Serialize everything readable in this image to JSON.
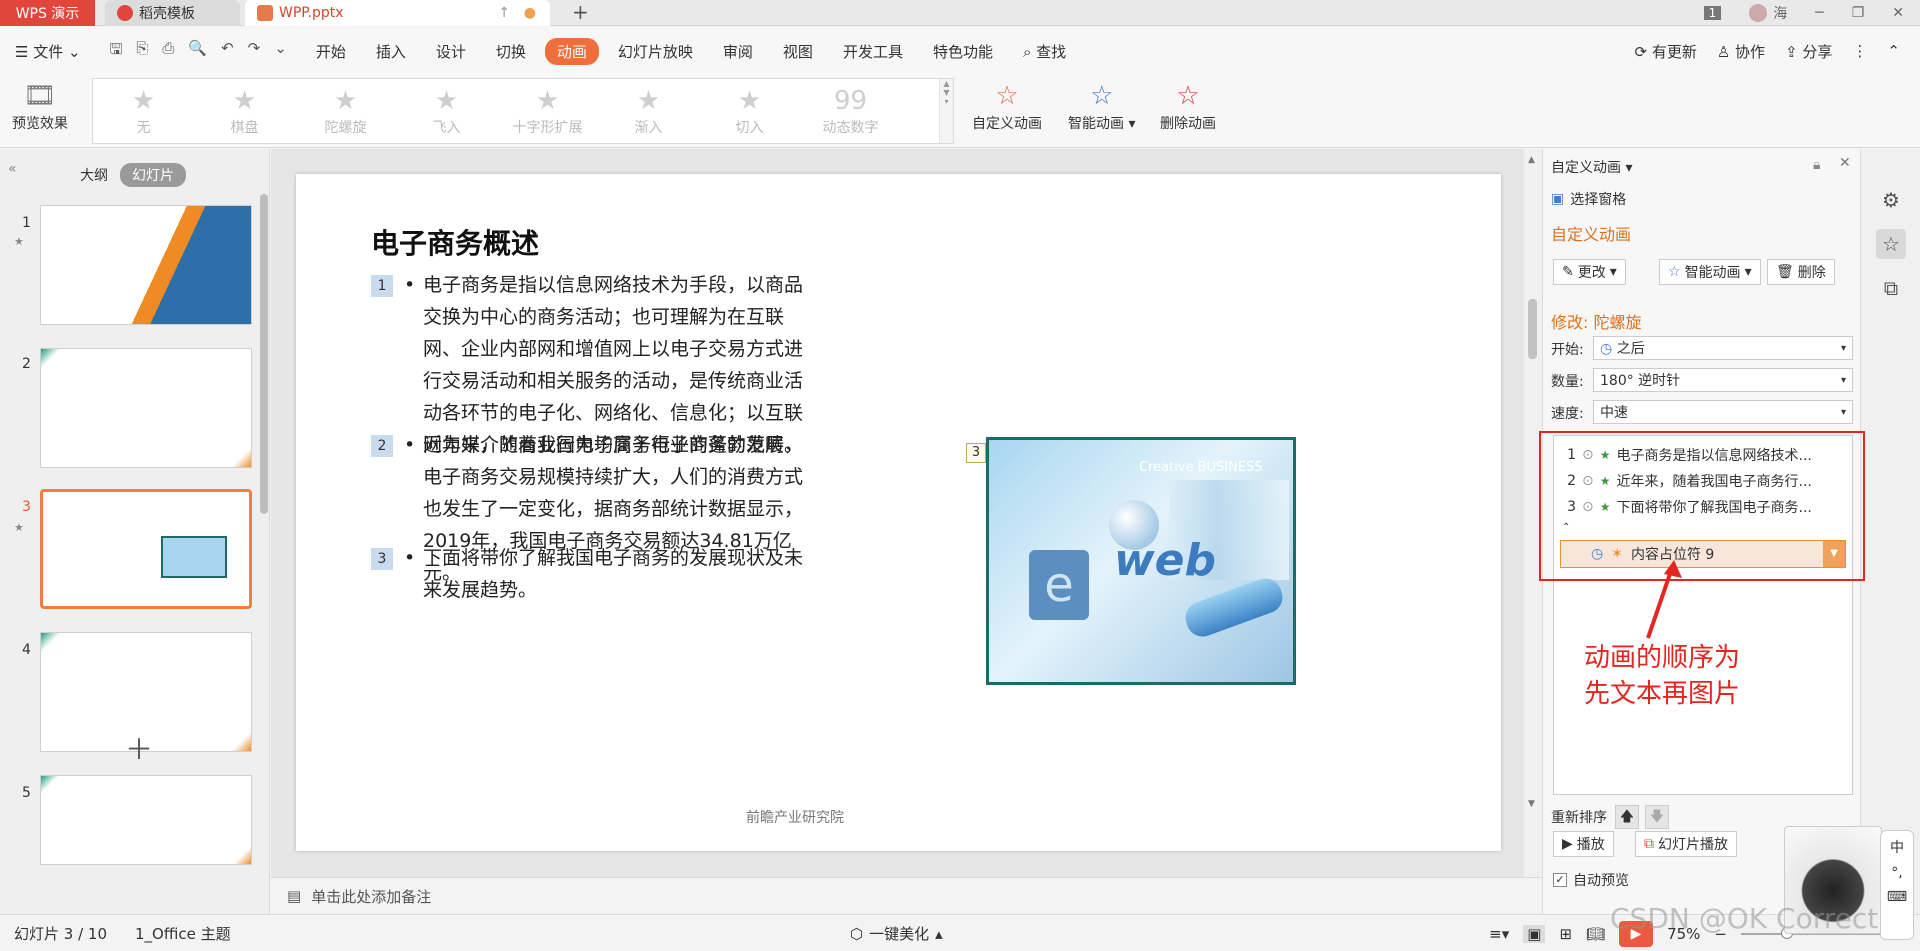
{
  "titlebar": {
    "app_tab": "WPS 演示",
    "tab2": "稻壳模板",
    "tab3": "WPP.pptx",
    "page_badge": "1",
    "user_name": "海"
  },
  "menu": {
    "file": "文件",
    "items": [
      "开始",
      "插入",
      "设计",
      "切换",
      "动画",
      "幻灯片放映",
      "审阅",
      "视图",
      "开发工具",
      "特色功能"
    ],
    "active_index": 4,
    "search": "查找",
    "right": [
      "有更新",
      "协作",
      "分享"
    ]
  },
  "ribbon": {
    "preview": "预览效果",
    "gallery": [
      "无",
      "棋盘",
      "陀螺旋",
      "飞入",
      "十字形扩展",
      "渐入",
      "切入",
      "动态数字"
    ],
    "custom": "自定义动画",
    "smart": "智能动画",
    "delete": "删除动画"
  },
  "left_panel": {
    "tab_outline": "大纲",
    "tab_slides": "幻灯片",
    "slide_numbers": [
      "1",
      "2",
      "3",
      "4",
      "5"
    ],
    "selected": 3
  },
  "slide": {
    "title": "电子商务概述",
    "paragraphs": [
      {
        "num": "1",
        "text": "电子商务是指以信息网络技术为手段，以商品交换为中心的商务活动；也可理解为在互联网、企业内部网和增值网上以电子交易方式进行交易活动和相关服务的活动，是传统商业活动各环节的电子化、网络化、信息化；以互联网为媒介的商业行为均属于电子商务的范畴。"
      },
      {
        "num": "2",
        "text": "近年来，随着我国电子商务行业的蓬勃发展，电子商务交易规模持续扩大，人们的消费方式也发生了一定变化，据商务部统计数据显示，2019年，我国电子商务交易额达34.81万亿元。"
      },
      {
        "num": "3",
        "text": "下面将带你了解我国电子商务的发展现状及未来发展趋势。"
      }
    ],
    "image_num": "3",
    "image_text_top": "Creative BUSINESS",
    "image_text_web": "web",
    "footer": "前瞻产业研究院"
  },
  "notes": {
    "placeholder": "单击此处添加备注"
  },
  "right_panel": {
    "title": "自定义动画",
    "select_pane": "选择窗格",
    "section_custom": "自定义动画",
    "btn_change": "更改",
    "btn_smart": "智能动画",
    "btn_delete": "删除",
    "modify_label": "修改: 陀螺旋",
    "start_label": "开始:",
    "start_value": "之后",
    "amount_label": "数量:",
    "amount_value": "180° 逆时针",
    "speed_label": "速度:",
    "speed_value": "中速",
    "animations": [
      {
        "num": "1",
        "text": "电子商务是指以信息网络技术..."
      },
      {
        "num": "2",
        "text": "近年来，随着我国电子商务行..."
      },
      {
        "num": "3",
        "text": "下面将带你了解我国电子商务..."
      }
    ],
    "selected_anim": "内容占位符 9",
    "reorder": "重新排序",
    "play": "播放",
    "slideshow": "幻灯片播放",
    "autopreview": "自动预览"
  },
  "annotation": {
    "line1": "动画的顺序为",
    "line2": "先文本再图片"
  },
  "status": {
    "slide_info": "幻灯片 3 / 10",
    "theme": "1_Office 主题",
    "beautify": "一键美化",
    "zoom": "75%",
    "watermark": "CSDN @OK Correct"
  },
  "ime": {
    "lang": "中"
  },
  "colors": {
    "accent": "#ee6e3c",
    "wps_red": "#e1463c",
    "annot_red": "#e3261f"
  }
}
